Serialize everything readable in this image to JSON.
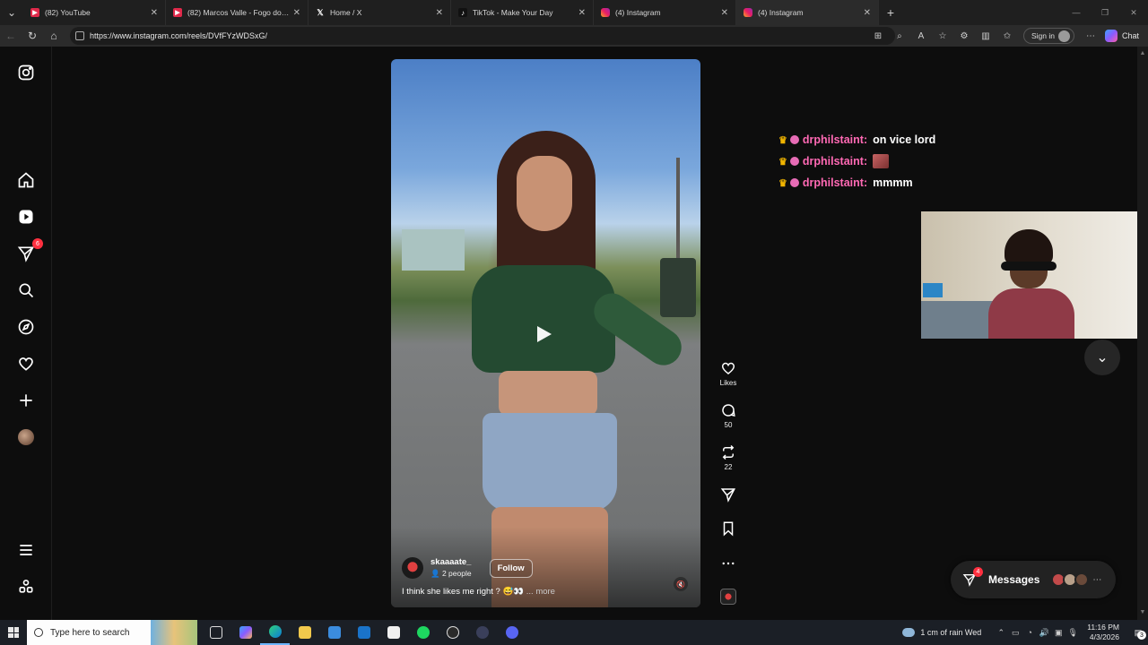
{
  "browser": {
    "tabs": [
      {
        "label": "(82) YouTube",
        "icon": "youtube-icon",
        "active": false
      },
      {
        "label": "(82) Marcos Valle - Fogo do Sol (R",
        "icon": "youtube-icon",
        "active": false
      },
      {
        "label": "Home / X",
        "icon": "x-icon",
        "active": false
      },
      {
        "label": "TikTok - Make Your Day",
        "icon": "tiktok-icon",
        "active": false
      },
      {
        "label": "(4) Instagram",
        "icon": "instagram-icon",
        "active": false
      },
      {
        "label": "(4) Instagram",
        "icon": "instagram-icon",
        "active": true
      }
    ],
    "url": "https://www.instagram.com/reels/DVfFYzWDSxG/",
    "sign_in_label": "Sign in",
    "chat_label": "Chat"
  },
  "sidebar": {
    "notifications_badge": "6"
  },
  "reel": {
    "username": "skaaaate_",
    "people": "2 people",
    "follow_label": "Follow",
    "caption": "I think she likes me right ? 😅👀",
    "more_label": "... more",
    "actions": {
      "likes_label": "Likes",
      "comments_count": "50",
      "reposts_count": "22"
    }
  },
  "stream_chat": [
    {
      "user": "drphilstaint",
      "message": "on vice lord",
      "emote": false
    },
    {
      "user": "drphilstaint",
      "message": "",
      "emote": true
    },
    {
      "user": "drphilstaint",
      "message": "mmmm",
      "emote": false
    }
  ],
  "messages_widget": {
    "label": "Messages",
    "badge": "4"
  },
  "taskbar": {
    "search_placeholder": "Type here to search",
    "weather": "1 cm of rain Wed",
    "time": "11:16 PM",
    "date": "4/3/2026",
    "notification_count": "3"
  },
  "colors": {
    "accent_pink": "#ff69b4",
    "badge_red": "#ff3040",
    "page_bg": "#0d0d0d"
  }
}
